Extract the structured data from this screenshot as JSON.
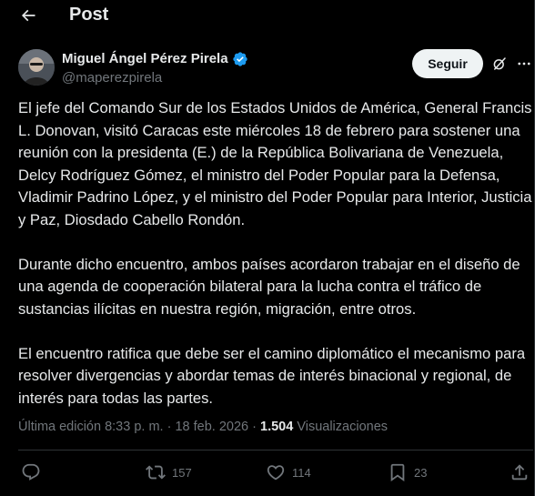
{
  "header": {
    "title": "Post"
  },
  "author": {
    "display_name": "Miguel Ángel Pérez Pirela",
    "handle": "@maperezpirela",
    "follow_label": "Seguir"
  },
  "tweet": {
    "paragraphs": [
      "El jefe del Comando Sur de los Estados Unidos de América, General Francis L. Donovan, visitó Caracas este miércoles 18 de febrero para sostener una reunión con la presidenta (E.) de la República Bolivariana de Venezuela, Delcy Rodríguez Gómez, el ministro del Poder Popular para la Defensa, Vladimir Padrino López, y el ministro del Poder Popular para Interior, Justicia y Paz, Diosdado Cabello Rondón.",
      "Durante dicho encuentro, ambos países acordaron trabajar en el diseño de una agenda de cooperación bilateral para la lucha contra el tráfico de sustancias ilícitas en nuestra región, migración, entre otros.",
      "El encuentro ratifica que debe ser el camino diplomático el mecanismo para resolver divergencias y abordar temas de interés binacional y regional, de interés para todas las partes."
    ],
    "edited_label": "Última edición 8:33 p. m.",
    "separator": " · ",
    "date": "18 feb. 2026",
    "views_count": "1.504",
    "views_label": "Visualizaciones"
  },
  "actions": {
    "replies": "",
    "reposts": "157",
    "likes": "114",
    "bookmarks": "23"
  },
  "icons": {
    "back": "arrow-left-icon",
    "verified": "verified-badge-icon",
    "grok": "grok-icon",
    "more": "more-horizontal-icon",
    "reply": "reply-icon",
    "repost": "repost-icon",
    "like": "heart-icon",
    "bookmark": "bookmark-icon",
    "share": "share-icon"
  },
  "colors": {
    "background": "#000000",
    "text": "#e7e9ea",
    "muted": "#71767b",
    "verified": "#1d9bf0",
    "follow_bg": "#eff3f4"
  }
}
